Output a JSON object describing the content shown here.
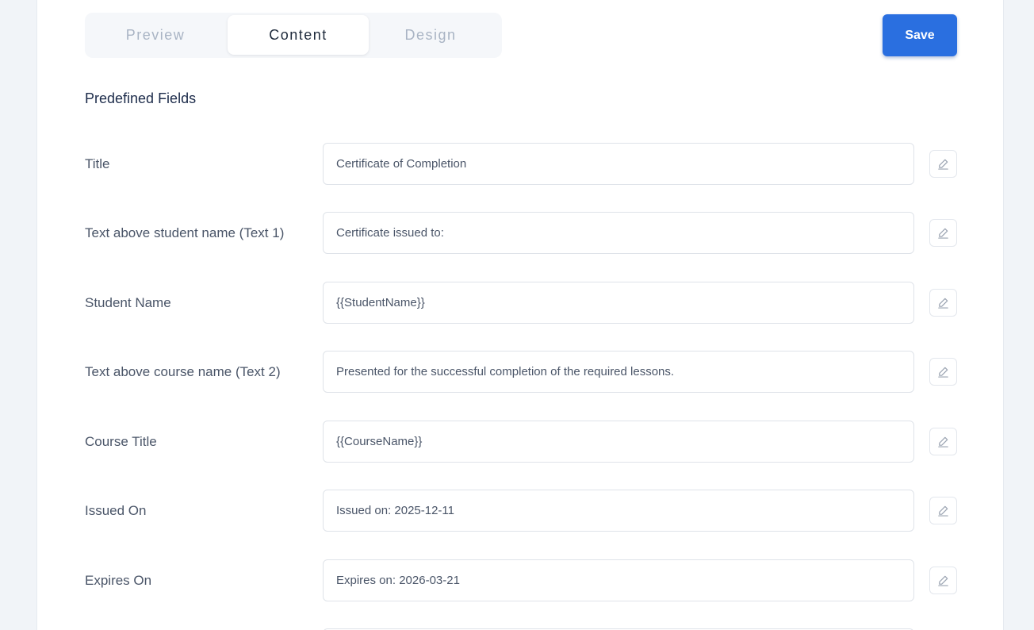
{
  "tabs": [
    {
      "label": "Preview",
      "active": false
    },
    {
      "label": "Content",
      "active": true
    },
    {
      "label": "Design",
      "active": false
    }
  ],
  "toolbar": {
    "save_label": "Save"
  },
  "section": {
    "title": "Predefined Fields"
  },
  "fields": [
    {
      "label": "Title",
      "value": "Certificate of Completion"
    },
    {
      "label": "Text above student name (Text 1)",
      "value": "Certificate issued to:"
    },
    {
      "label": "Student Name",
      "value": "{{StudentName}}"
    },
    {
      "label": "Text above course name (Text 2)",
      "value": "Presented for the successful completion of the required lessons."
    },
    {
      "label": "Course Title",
      "value": "{{CourseName}}"
    },
    {
      "label": "Issued On",
      "value": "Issued on: 2025-12-11"
    },
    {
      "label": "Expires On",
      "value": "Expires on: 2026-03-21"
    }
  ],
  "icons": {
    "edit": "pencil-icon"
  },
  "colors": {
    "accent": "#2a6fe0",
    "background": "#f1f4f8"
  }
}
